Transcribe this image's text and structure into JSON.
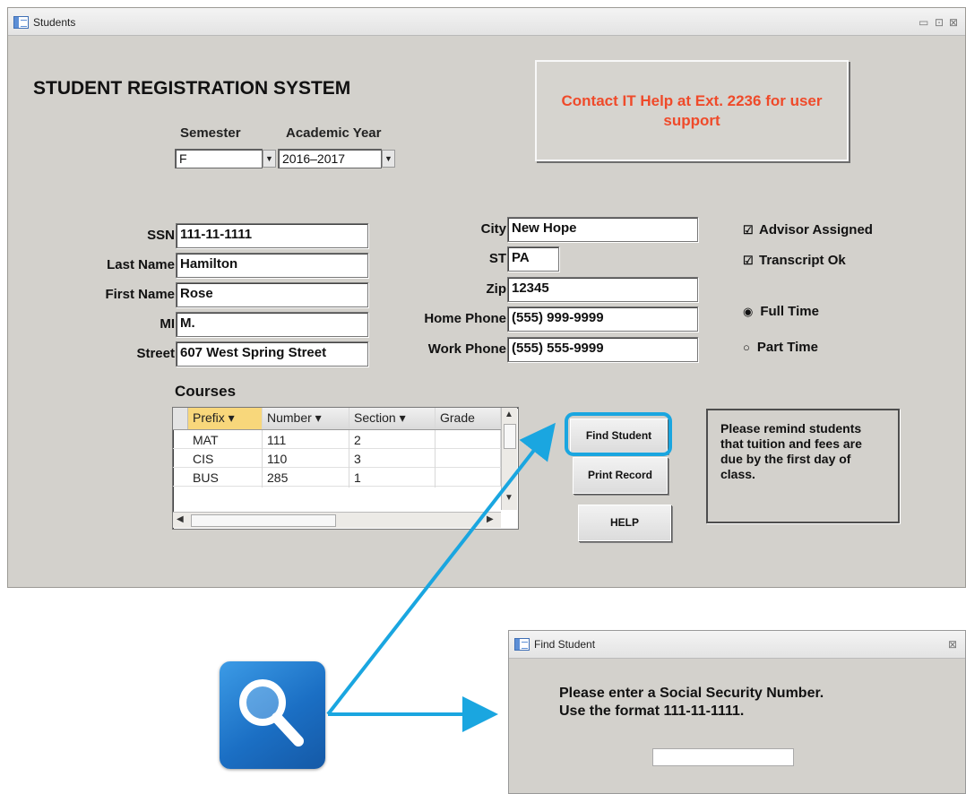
{
  "main_window": {
    "title": "Students",
    "controls": [
      "▭",
      "⊡",
      "⊠"
    ],
    "heading": "STUDENT REGISTRATION SYSTEM",
    "contact_box": "Contact IT Help at Ext. 2236 for user support",
    "semester": {
      "label": "Semester",
      "value": "F"
    },
    "academic_year": {
      "label": "Academic Year",
      "value": "2016–2017"
    },
    "fields_left": [
      {
        "label": "SSN",
        "value": "111-11-1111"
      },
      {
        "label": "Last Name",
        "value": "Hamilton"
      },
      {
        "label": "First Name",
        "value": "Rose"
      },
      {
        "label": "MI",
        "value": "M."
      },
      {
        "label": "Street",
        "value": "607 West Spring Street"
      }
    ],
    "fields_right": [
      {
        "label": "City",
        "value": "New Hope"
      },
      {
        "label": "ST",
        "value": "PA"
      },
      {
        "label": "Zip",
        "value": "12345"
      },
      {
        "label": "Home Phone",
        "value": "(555) 999-9999"
      },
      {
        "label": "Work Phone",
        "value": "(555) 555-9999"
      }
    ],
    "checkboxes": [
      {
        "label": "Advisor Assigned",
        "checked": true
      },
      {
        "label": "Transcript Ok",
        "checked": true
      }
    ],
    "radios": [
      {
        "label": "Full Time",
        "selected": true
      },
      {
        "label": "Part Time",
        "selected": false
      }
    ],
    "courses": {
      "label": "Courses",
      "headers": [
        "Prefix",
        "Number",
        "Section",
        "Grade"
      ],
      "rows": [
        [
          "MAT",
          "111",
          "2",
          ""
        ],
        [
          "CIS",
          "110",
          "3",
          ""
        ],
        [
          "BUS",
          "285",
          "1",
          ""
        ]
      ]
    },
    "buttons": {
      "find": "Find Student",
      "print": "Print Record",
      "help": "HELP"
    },
    "reminder": "Please remind students that tuition and fees are due by the first day of class."
  },
  "find_dialog": {
    "title": "Find Student",
    "message_line1": "Please enter a Social Security Number.",
    "message_line2": "Use the format 111-11-1111.",
    "input_value": "",
    "close": "⊠"
  },
  "callout": {
    "icon": "magnifier-icon",
    "highlight_color": "#1aa6e0",
    "tile_color": "#1b6fc4"
  }
}
